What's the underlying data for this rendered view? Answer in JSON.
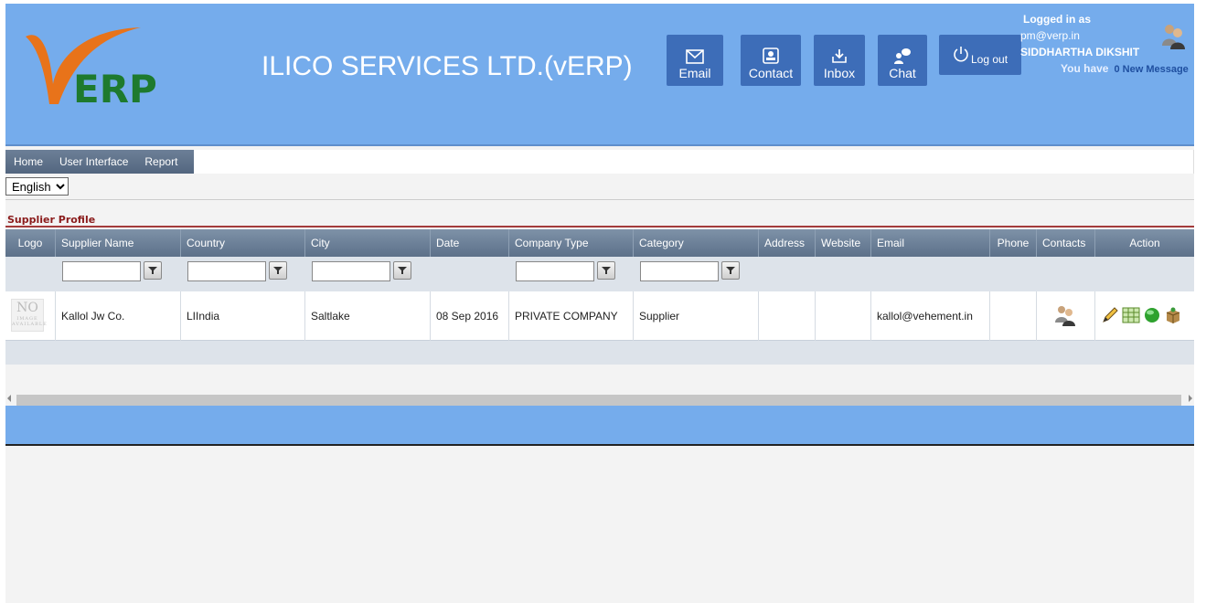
{
  "header": {
    "company_name": "ILICO SERVICES LTD.(vERP)",
    "logo_text": "ERP",
    "buttons": {
      "email": "Email",
      "contact": "Contact",
      "inbox": "Inbox",
      "chat": "Chat",
      "logout": "Log out"
    },
    "user": {
      "logged_in_label": "Logged in as",
      "email": "pm@verp.in",
      "name": "SIDDHARTHA DIKSHIT",
      "messages_prefix": "You have",
      "messages_count": "0 New Message"
    }
  },
  "menu": {
    "items": [
      "Home",
      "User Interface",
      "Report"
    ]
  },
  "language": {
    "selected": "English"
  },
  "section": {
    "title": "Supplier Profile"
  },
  "table": {
    "columns": [
      "Logo",
      "Supplier Name",
      "Country",
      "City",
      "Date",
      "Company Type",
      "Category",
      "Address",
      "Website",
      "Email",
      "Phone",
      "Contacts",
      "Action"
    ],
    "rows": [
      {
        "logo": "NO IMAGE AVAILABLE",
        "supplier_name": "Kallol Jw Co.",
        "country": "LIIndia",
        "city": "Saltlake",
        "date": "08 Sep 2016",
        "company_type": "PRIVATE COMPANY",
        "category": "Supplier",
        "address": "",
        "website": "",
        "email": "kallol@vehement.in",
        "phone": ""
      }
    ]
  },
  "colors": {
    "header_bg": "#75acec",
    "toolbar_button": "#3d6db8",
    "section_title": "#8b1c1c"
  }
}
